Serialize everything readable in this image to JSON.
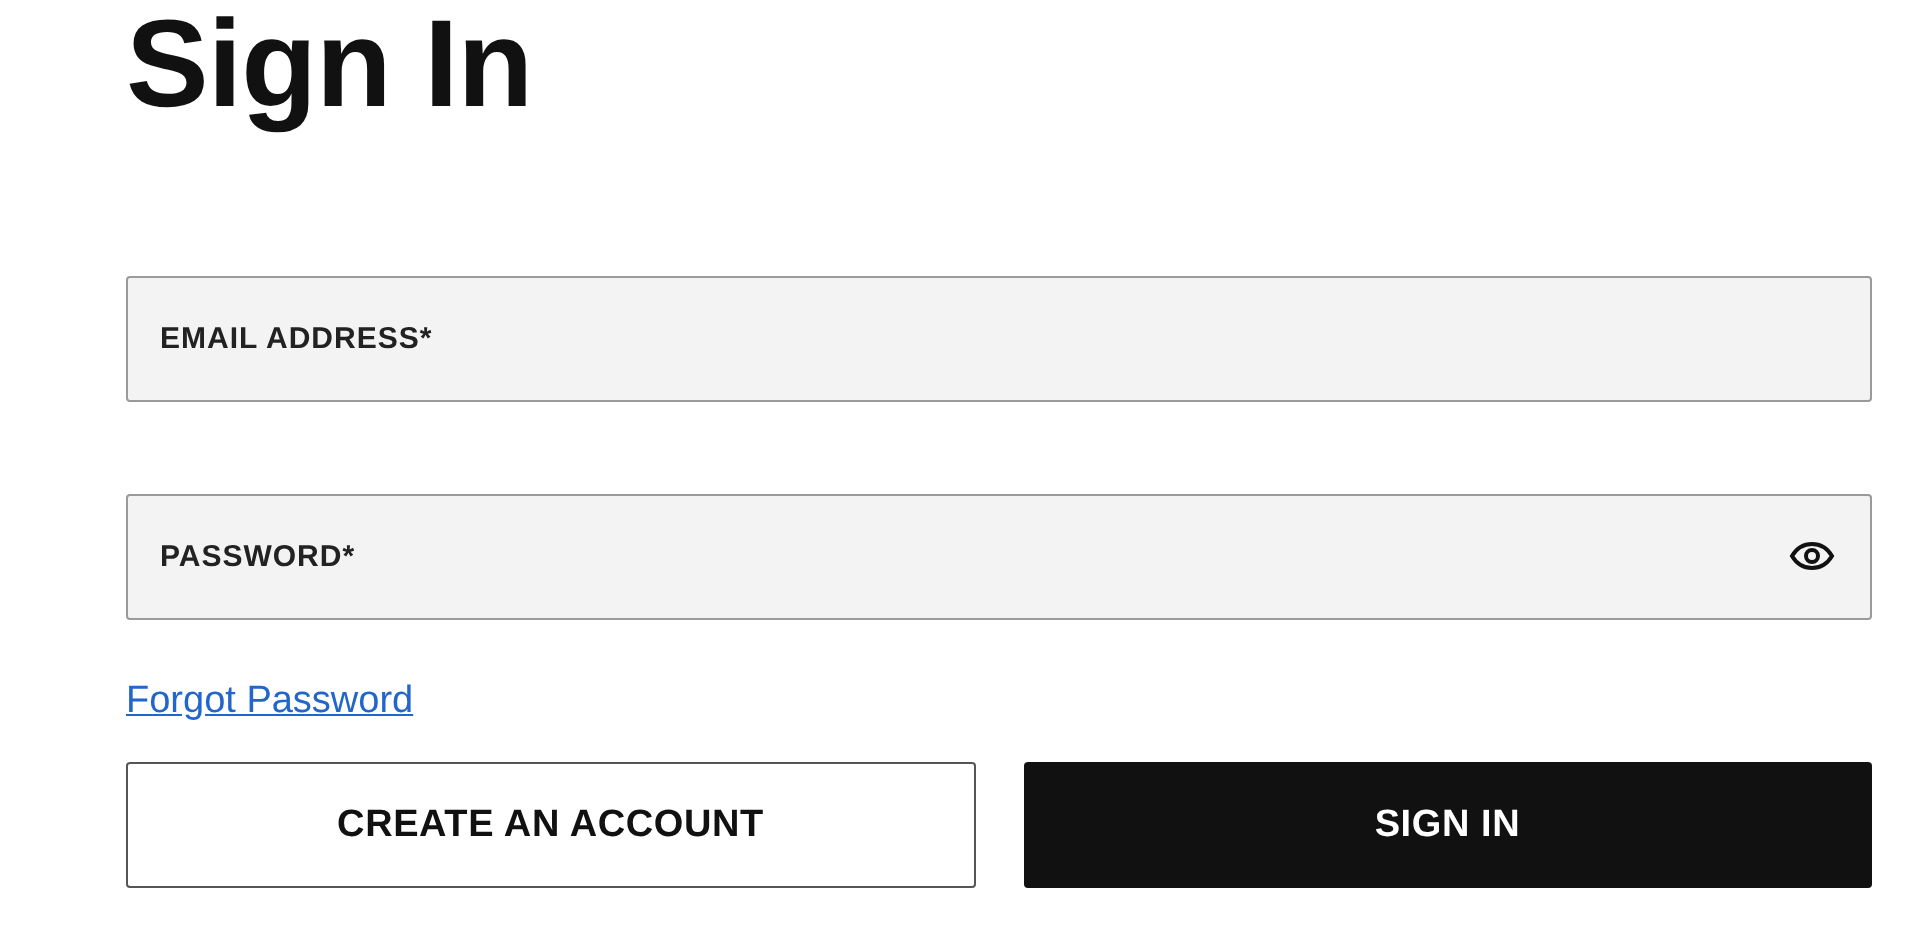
{
  "title": "Sign In",
  "fields": [
    {
      "kind": "text",
      "placeholder": "EMAIL ADDRESS*"
    },
    {
      "kind": "password",
      "placeholder": "PASSWORD*"
    }
  ],
  "forgot_link": "Forgot Password",
  "buttons": [
    {
      "label": "CREATE AN ACCOUNT",
      "kind": "secondary"
    },
    {
      "label": "SIGN IN",
      "kind": "primary"
    }
  ]
}
